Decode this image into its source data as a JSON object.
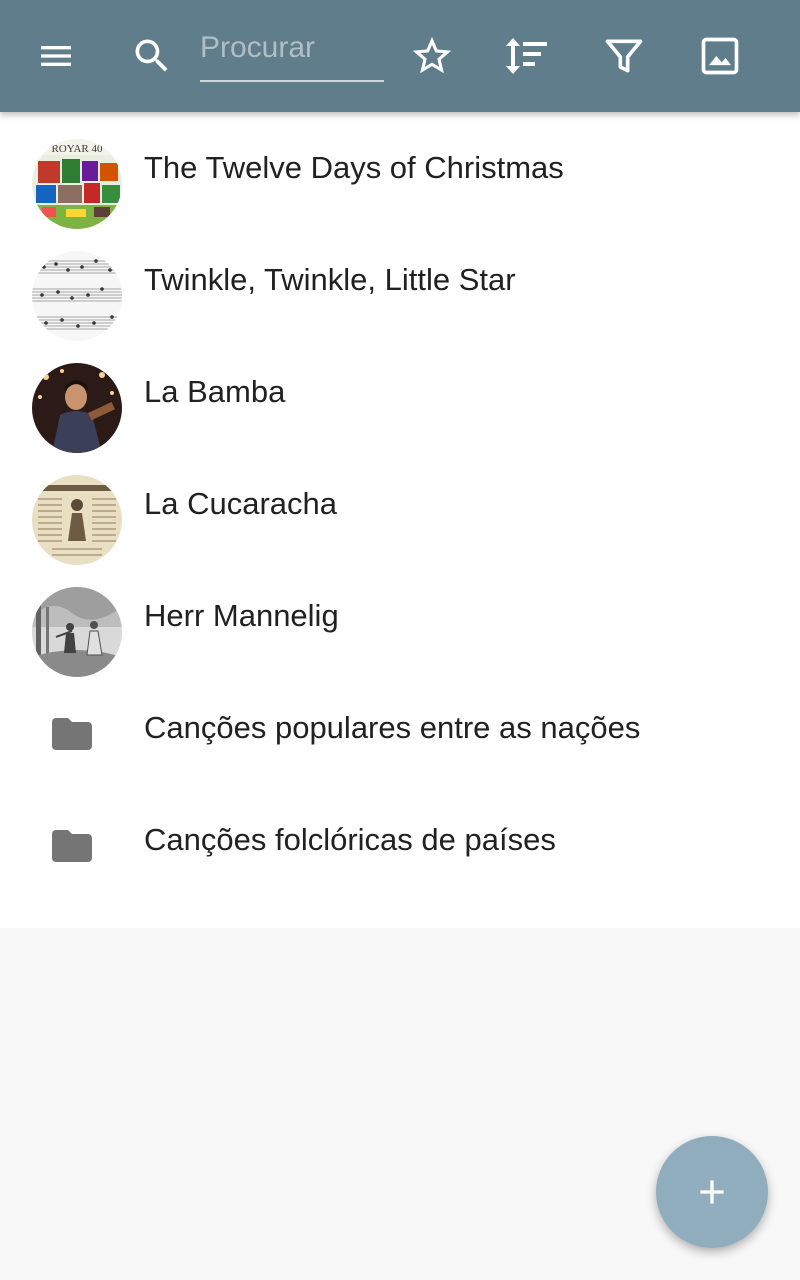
{
  "colors": {
    "toolbar": "#607d8b",
    "fab": "#90adbd",
    "folder": "#757575",
    "text": "#212121"
  },
  "toolbar": {
    "menu_icon": "menu-icon",
    "search_icon": "search-icon",
    "search_placeholder": "Procurar",
    "search_value": "",
    "star_icon": "star-outline-icon",
    "sort_icon": "sort-icon",
    "filter_icon": "filter-icon",
    "image_icon": "image-icon"
  },
  "list": {
    "items": [
      {
        "label": "The Twelve Days of Christmas",
        "kind": "song",
        "thumb": "christmas-thumbnail"
      },
      {
        "label": "Twinkle, Twinkle, Little Star",
        "kind": "song",
        "thumb": "sheet-music-thumbnail"
      },
      {
        "label": "La Bamba",
        "kind": "song",
        "thumb": "performer-thumbnail"
      },
      {
        "label": "La Cucaracha",
        "kind": "song",
        "thumb": "broadside-thumbnail"
      },
      {
        "label": "Herr Mannelig",
        "kind": "song",
        "thumb": "engraving-thumbnail"
      },
      {
        "label": "Canções populares entre as nações",
        "kind": "folder",
        "thumb": "folder-icon"
      },
      {
        "label": "Canções folclóricas de países",
        "kind": "folder",
        "thumb": "folder-icon"
      }
    ]
  },
  "fab": {
    "icon": "plus-icon"
  }
}
